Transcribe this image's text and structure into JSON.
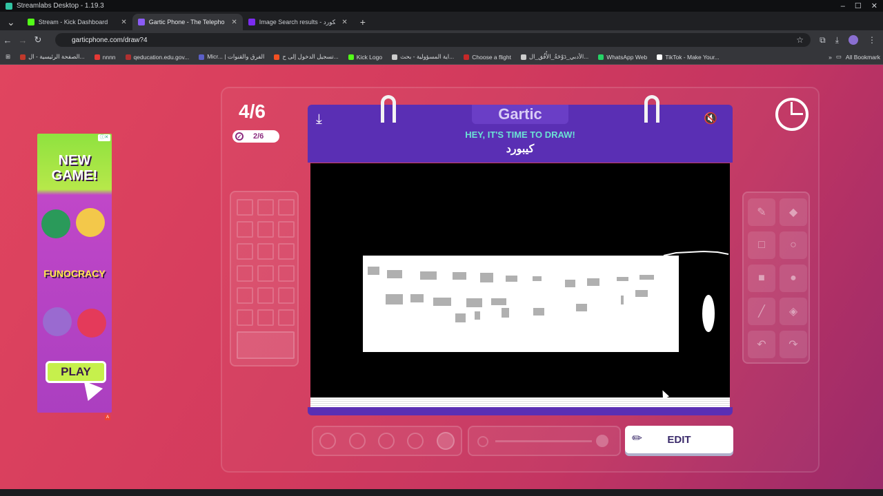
{
  "window": {
    "title": "Streamlabs Desktop - 1.19.3"
  },
  "tabs": [
    {
      "label": "Stream - Kick Dashboard",
      "color": "#53fc18"
    },
    {
      "label": "Gartic Phone - The Telephone G",
      "color": "#8b5cf6"
    },
    {
      "label": "Image Search results - ديسكورد",
      "color": "#7b2cf0"
    }
  ],
  "url": "garticphone.com/draw?4",
  "bookmarks": [
    {
      "label": "الصفحة الرئيسية - ال...",
      "color": "#c0392b"
    },
    {
      "label": "nnnn",
      "color": "#e53935"
    },
    {
      "label": "qeducation.edu.gov...",
      "color": "#b03030"
    },
    {
      "label": "Micr... | الفرق والقنوات",
      "color": "#5b5fc7"
    },
    {
      "label": "تسجيل الدخول إلى ح...",
      "color": "#f25022"
    },
    {
      "label": "Kick Logo",
      "color": "#53fc18"
    },
    {
      "label": "اية المسؤولية - بحث...",
      "color": "#cccccc"
    },
    {
      "label": "Choose a flight",
      "color": "#c62828"
    },
    {
      "label": "الأدبي_دَوْحَةُ_الأُفُق_ال...",
      "color": "#cccccc"
    },
    {
      "label": "WhatsApp Web",
      "color": "#25d366"
    },
    {
      "label": "TikTok - Make Your...",
      "color": "#ffffff"
    }
  ],
  "bookmarks_all": "All Bookmark",
  "game": {
    "round": "4/6",
    "done": "2/6",
    "logo": "Gartic",
    "prompt_title": "HEY, IT'S TIME TO DRAW!",
    "prompt_word": "كيبورد",
    "edit_label": "EDIT"
  },
  "ad": {
    "headline": "NEW GAME!",
    "brand": "FUNOCRACY",
    "cta": "PLAY"
  },
  "colors": {
    "accent": "#5a2fb4",
    "prompt": "#6be3d4",
    "background": "#d23a5d"
  }
}
